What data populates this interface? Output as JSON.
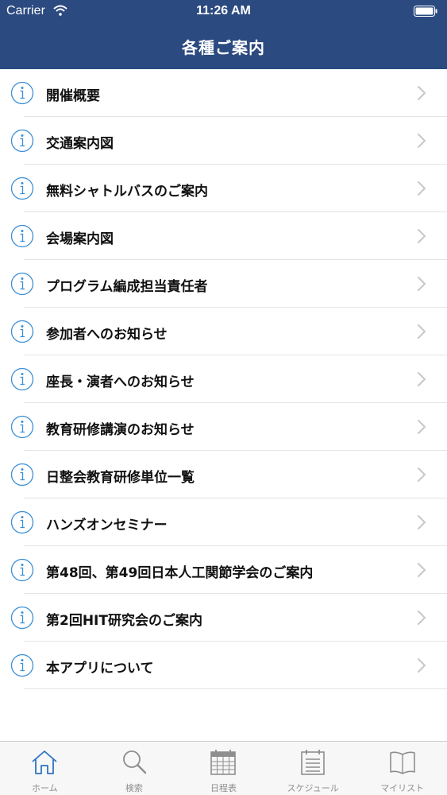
{
  "status_bar": {
    "carrier": "Carrier",
    "time": "11:26 AM"
  },
  "nav": {
    "title": "各種ご案内"
  },
  "items": [
    {
      "label": "開催概要"
    },
    {
      "label": "交通案内図"
    },
    {
      "label": "無料シャトルバスのご案内"
    },
    {
      "label": "会場案内図"
    },
    {
      "label": "プログラム編成担当責任者"
    },
    {
      "label": "参加者へのお知らせ"
    },
    {
      "label": "座長・演者へのお知らせ"
    },
    {
      "label": "教育研修講演のお知らせ"
    },
    {
      "label": "日整会教育研修単位一覧"
    },
    {
      "label": "ハンズオンセミナー"
    },
    {
      "label": "第48回、第49回日本人工関節学会のご案内"
    },
    {
      "label": "第2回HIT研究会のご案内"
    },
    {
      "label": "本アプリについて"
    }
  ],
  "tabs": [
    {
      "label": "ホーム",
      "icon": "home-icon",
      "active": true
    },
    {
      "label": "検索",
      "icon": "search-icon",
      "active": false
    },
    {
      "label": "日程表",
      "icon": "calendar-icon",
      "active": false
    },
    {
      "label": "スケジュール",
      "icon": "schedule-icon",
      "active": false
    },
    {
      "label": "マイリスト",
      "icon": "book-icon",
      "active": false
    }
  ],
  "colors": {
    "nav_bar": "#2b4a80",
    "accent": "#2e74c4",
    "inactive_tab": "#8e8e8e",
    "info_icon": "#3b8fd6"
  }
}
